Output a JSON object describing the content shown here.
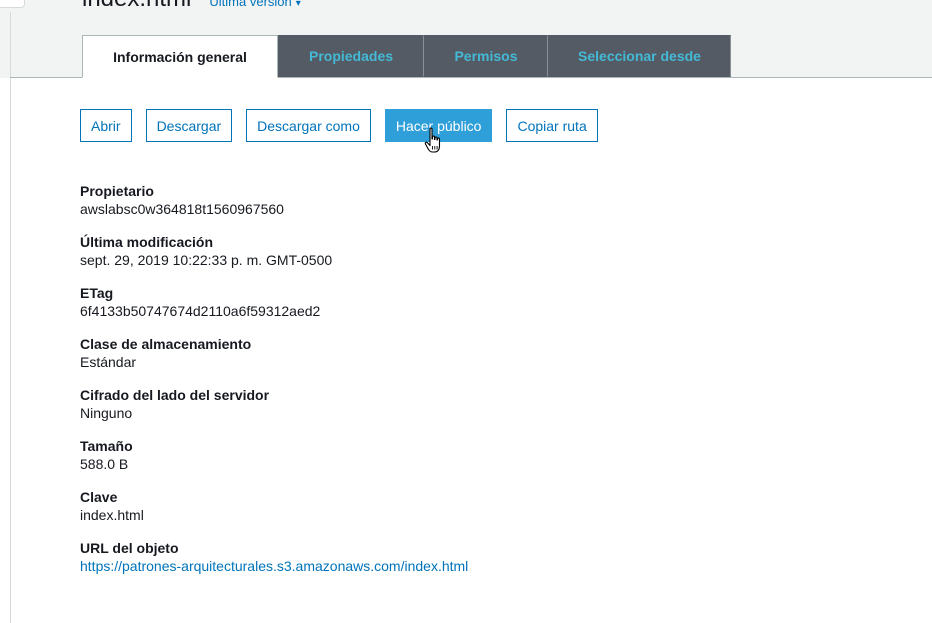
{
  "header": {
    "object_name": "index.html",
    "version_label": "Última versión",
    "version_caret": "▾"
  },
  "tabs": [
    {
      "label": "Información general",
      "active": true
    },
    {
      "label": "Propiedades",
      "active": false
    },
    {
      "label": "Permisos",
      "active": false
    },
    {
      "label": "Seleccionar desde",
      "active": false
    }
  ],
  "actions": {
    "open": "Abrir",
    "download": "Descargar",
    "download_as": "Descargar como",
    "make_public": "Hacer público",
    "copy_path": "Copiar ruta"
  },
  "properties": {
    "owner": {
      "label": "Propietario",
      "value": "awslabsc0w364818t1560967560"
    },
    "last_modified": {
      "label": "Última modificación",
      "value": "sept. 29, 2019 10:22:33 p. m. GMT-0500"
    },
    "etag": {
      "label": "ETag",
      "value": "6f4133b50747674d2110a6f59312aed2"
    },
    "storage_class": {
      "label": "Clase de almacenamiento",
      "value": "Estándar"
    },
    "encryption": {
      "label": "Cifrado del lado del servidor",
      "value": "Ninguno"
    },
    "size": {
      "label": "Tamaño",
      "value": "588.0 B"
    },
    "key": {
      "label": "Clave",
      "value": "index.html"
    },
    "object_url": {
      "label": "URL del objeto",
      "value": "https://patrones-arquitecturales.s3.amazonaws.com/index.html"
    }
  },
  "colors": {
    "accent": "#0073bb",
    "primary_button": "#2e9fd8",
    "inactive_tab_bg": "#545b64",
    "inactive_tab_text": "#44b9d6"
  },
  "icons": {
    "cursor": "hand-pointer-icon"
  }
}
